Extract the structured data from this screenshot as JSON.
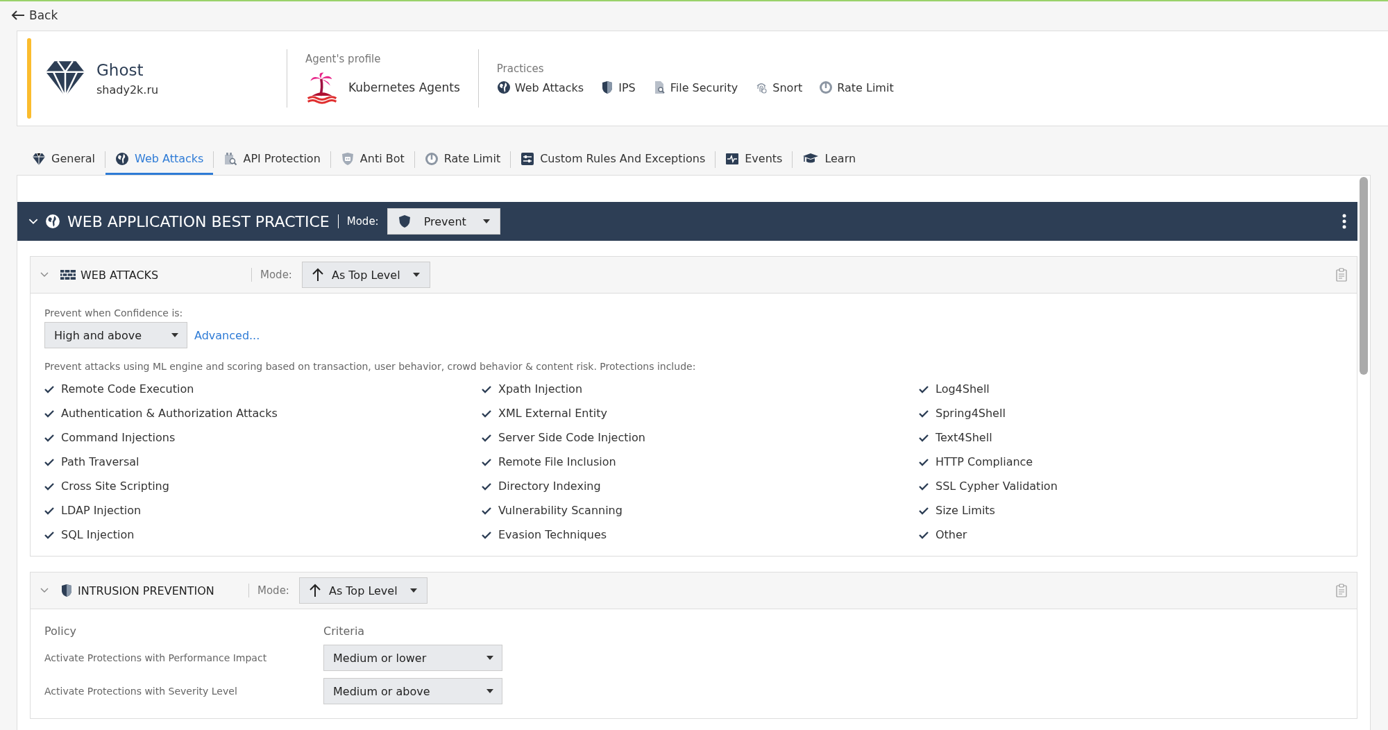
{
  "back": {
    "label": "Back"
  },
  "asset": {
    "name": "Ghost",
    "domain": "shady2k.ru"
  },
  "profile": {
    "heading": "Agent's profile",
    "name": "Kubernetes Agents"
  },
  "practices": {
    "heading": "Practices",
    "items": [
      {
        "kind": "globe",
        "label": "Web Attacks"
      },
      {
        "kind": "shield",
        "label": "IPS"
      },
      {
        "kind": "file",
        "label": "File Security"
      },
      {
        "kind": "fingerprint",
        "label": "Snort"
      },
      {
        "kind": "gauge",
        "label": "Rate Limit"
      }
    ]
  },
  "tabs": [
    {
      "kind": "diamond",
      "label": "General",
      "selected": false
    },
    {
      "kind": "globe",
      "label": "Web Attacks",
      "selected": true
    },
    {
      "kind": "api",
      "label": "API Protection",
      "selected": false
    },
    {
      "kind": "bot",
      "label": "Anti Bot",
      "selected": false
    },
    {
      "kind": "gauge",
      "label": "Rate Limit",
      "selected": false
    },
    {
      "kind": "sliders",
      "label": "Custom Rules And Exceptions",
      "selected": false
    },
    {
      "kind": "pulse",
      "label": "Events",
      "selected": false
    },
    {
      "kind": "cap",
      "label": "Learn",
      "selected": false
    }
  ],
  "practice": {
    "title": "WEB APPLICATION BEST PRACTICE",
    "mode_label": "Mode:",
    "mode": "Prevent"
  },
  "web_attacks": {
    "title": "WEB ATTACKS",
    "mode_label": "Mode:",
    "mode": "As Top Level",
    "confidence_label": "Prevent when Confidence is:",
    "confidence": "High and above",
    "advanced": "Advanced...",
    "description": "Prevent attacks using ML engine and scoring based on transaction, user behavior, crowd behavior & content risk. Protections include:",
    "protections": [
      [
        "Remote Code Execution",
        "Authentication & Authorization Attacks",
        "Command Injections",
        "Path Traversal",
        "Cross Site Scripting",
        "LDAP Injection",
        "SQL Injection"
      ],
      [
        "Xpath Injection",
        "XML External Entity",
        "Server Side Code Injection",
        "Remote File Inclusion",
        "Directory Indexing",
        "Vulnerability Scanning",
        "Evasion Techniques"
      ],
      [
        "Log4Shell",
        "Spring4Shell",
        "Text4Shell",
        "HTTP Compliance",
        "SSL Cypher Validation",
        "Size Limits",
        "Other"
      ]
    ]
  },
  "intrusion_prevention": {
    "title": "INTRUSION PREVENTION",
    "mode_label": "Mode:",
    "mode": "As Top Level",
    "policy_heading": "Policy",
    "criteria_heading": "Criteria",
    "rows": [
      {
        "policy": "Activate Protections with Performance Impact",
        "criteria": "Medium or lower"
      },
      {
        "policy": "Activate Protections with Severity Level",
        "criteria": "Medium or above"
      }
    ]
  }
}
